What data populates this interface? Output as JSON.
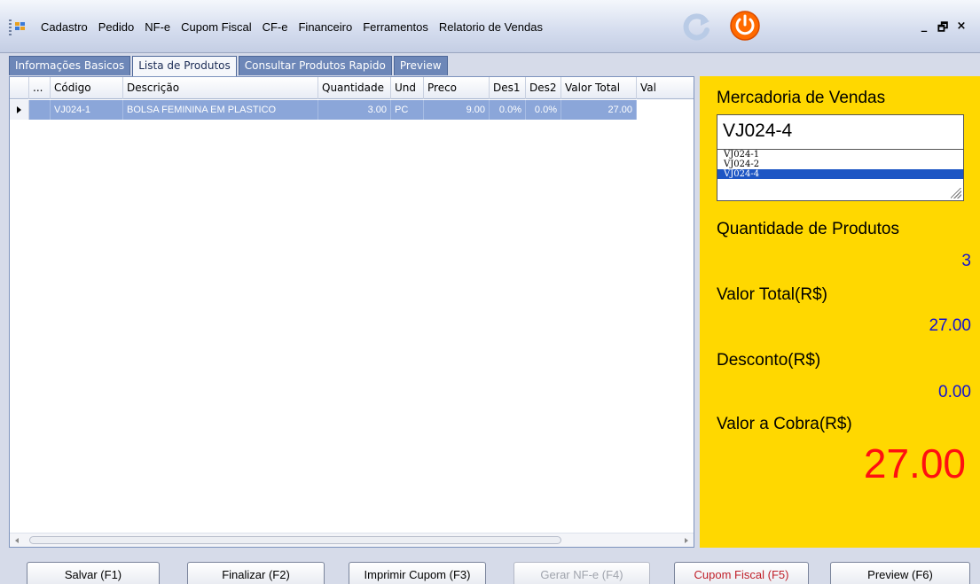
{
  "menu": {
    "items": [
      "Cadastro",
      "Pedido",
      "NF-e",
      "Cupom Fiscal",
      "CF-e",
      "Financeiro",
      "Ferramentos",
      "Relatorio de Vendas"
    ],
    "window_controls": [
      "_",
      "🗗",
      "×"
    ]
  },
  "tabs": [
    {
      "label": "Informações Basicos",
      "active": false
    },
    {
      "label": "Lista de Produtos",
      "active": true
    },
    {
      "label": "Consultar Produtos Rapido",
      "active": false
    },
    {
      "label": "Preview",
      "active": false
    }
  ],
  "grid": {
    "columns": [
      "...",
      "Código",
      "Descrição",
      "Quantidade",
      "Und",
      "Preco",
      "Des1",
      "Des2",
      "Valor Total",
      "Val"
    ],
    "rows": [
      [
        "VJ024-1",
        "BOLSA FEMININA EM PLASTICO",
        "3.00",
        "PC",
        "9.00",
        "0.0%",
        "0.0%",
        "27.00"
      ]
    ]
  },
  "panel": {
    "mercadoria_label": "Mercadoria de Vendas",
    "product_input_value": "VJ024-4",
    "product_options": [
      "VJ024-1",
      "VJ024-2",
      "VJ024-4"
    ],
    "selected_option": "VJ024-4",
    "quantidade_label": "Quantidade de Produtos",
    "quantidade_value": "3",
    "valor_total_label": "Valor Total(R$)",
    "valor_total_value": "27.00",
    "desconto_label": "Desconto(R$)",
    "desconto_value": "0.00",
    "valor_cobra_label": "Valor a Cobra(R$)",
    "valor_cobra_value": "27.00",
    "accent_color": "#ffd800",
    "total_color": "#ff1010"
  },
  "footer": {
    "salvar": "Salvar (F1)",
    "finalizar": "Finalizar (F2)",
    "imprimir": "Imprimir Cupom (F3)",
    "gerar_nfe": "Gerar NF-e (F4)",
    "cupom_fiscal": "Cupom Fiscal (F5)",
    "preview": "Preview (F6)"
  },
  "icons": [
    "grip-icon",
    "app-icon",
    "refresh-icon",
    "power-icon",
    "minimize-icon",
    "restore-icon",
    "close-icon"
  ]
}
